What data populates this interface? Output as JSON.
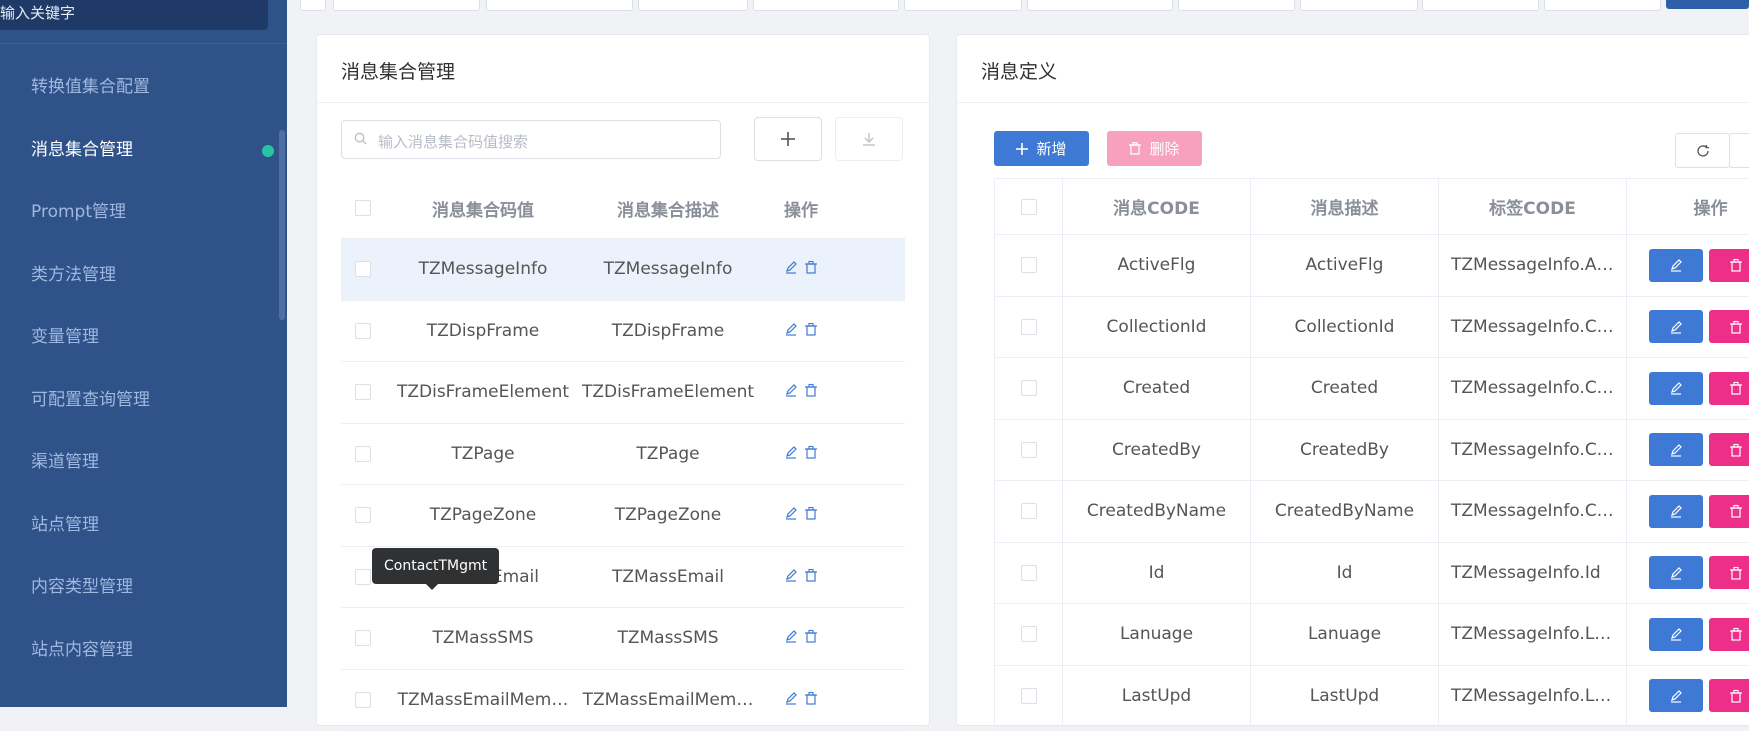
{
  "sidebar": {
    "search_text": "输入关键字",
    "items": [
      {
        "label": "转换值集合配置"
      },
      {
        "label": "消息集合管理",
        "active": true
      },
      {
        "label": "Prompt管理"
      },
      {
        "label": "类方法管理"
      },
      {
        "label": "变量管理"
      },
      {
        "label": "可配置查询管理"
      },
      {
        "label": "渠道管理"
      },
      {
        "label": "站点管理"
      },
      {
        "label": "内容类型管理"
      },
      {
        "label": "站点内容管理"
      }
    ]
  },
  "left_panel": {
    "title": "消息集合管理",
    "search_placeholder": "输入消息集合码值搜索",
    "columns": [
      "消息集合码值",
      "消息集合描述",
      "操作"
    ],
    "rows": [
      {
        "code": "TZMessageInfo",
        "desc": "TZMessageInfo",
        "selected": true
      },
      {
        "code": "TZDispFrame",
        "desc": "TZDispFrame"
      },
      {
        "code": "TZDisFrameElement",
        "desc": "TZDisFrameElement"
      },
      {
        "code": "TZPage",
        "desc": "TZPage"
      },
      {
        "code": "TZPageZone",
        "desc": "TZPageZone"
      },
      {
        "code": "TZMassEmail",
        "desc": "TZMassEmail"
      },
      {
        "code": "TZMassSMS",
        "desc": "TZMassSMS"
      },
      {
        "code": "TZMassEmailMem…",
        "desc": "TZMassEmailMem…"
      }
    ],
    "tooltip": "ContactTMgmt"
  },
  "right_panel": {
    "title": "消息定义",
    "add_label": "新增",
    "delete_label": "删除",
    "columns": [
      "消息CODE",
      "消息描述",
      "标签CODE",
      "操作"
    ],
    "rows": [
      {
        "code": "ActiveFlg",
        "desc": "ActiveFlg",
        "tag": "TZMessageInfo.A…"
      },
      {
        "code": "CollectionId",
        "desc": "CollectionId",
        "tag": "TZMessageInfo.C…"
      },
      {
        "code": "Created",
        "desc": "Created",
        "tag": "TZMessageInfo.C…"
      },
      {
        "code": "CreatedBy",
        "desc": "CreatedBy",
        "tag": "TZMessageInfo.C…"
      },
      {
        "code": "CreatedByName",
        "desc": "CreatedByName",
        "tag": "TZMessageInfo.C…"
      },
      {
        "code": "Id",
        "desc": "Id",
        "tag": "TZMessageInfo.Id"
      },
      {
        "code": "Lanuage",
        "desc": "Lanuage",
        "tag": "TZMessageInfo.L…"
      },
      {
        "code": "LastUpd",
        "desc": "LastUpd",
        "tag": "TZMessageInfo.L…"
      }
    ]
  },
  "colors": {
    "sidebar_bg": "#2f5289",
    "active_dot": "#27c6a2",
    "primary": "#3e79d6",
    "danger": "#ee2f8a",
    "danger_disabled": "#f7a1bf"
  }
}
